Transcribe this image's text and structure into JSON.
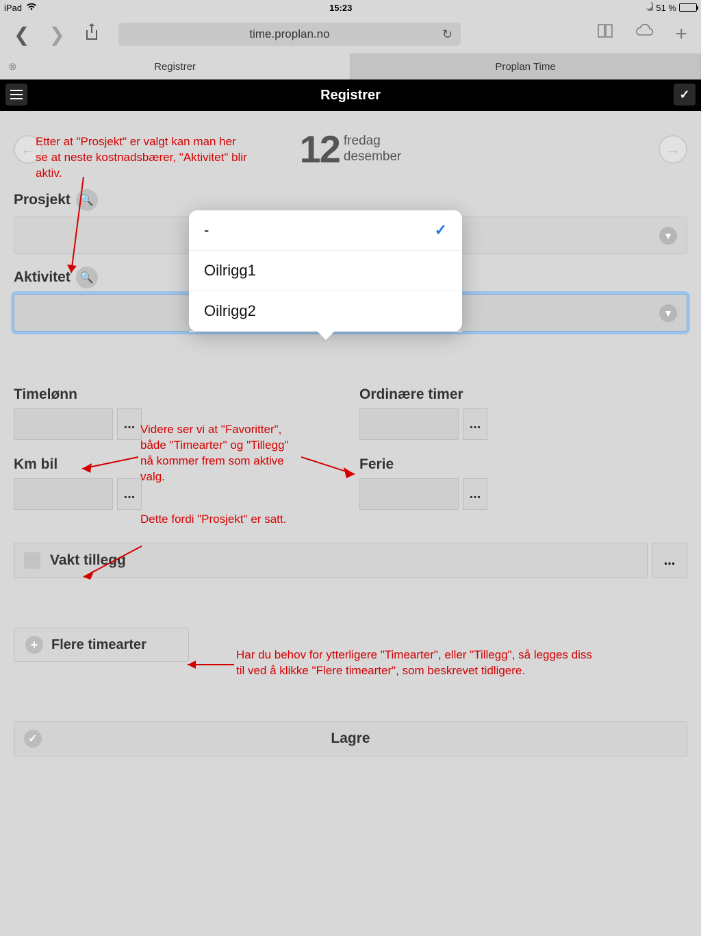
{
  "status": {
    "device": "iPad",
    "time": "15:23",
    "battery_pct": "51 %"
  },
  "browser": {
    "url": "time.proplan.no"
  },
  "tabs": {
    "active": "Registrer",
    "inactive": "Proplan Time"
  },
  "header": {
    "title": "Registrer"
  },
  "date": {
    "day_num": "12",
    "weekday": "fredag",
    "month": "desember"
  },
  "sections": {
    "prosjekt_label": "Prosjekt",
    "aktivitet_label": "Aktivitet",
    "aktivitet_value": "-"
  },
  "popover": {
    "items": [
      "-",
      "Oilrigg1",
      "Oilrigg2"
    ],
    "selected_index": 0
  },
  "fields": {
    "timelonn": "Timelønn",
    "ordinaere": "Ordinære timer",
    "kmbil": "Km bil",
    "ferie": "Ferie",
    "dots": "..."
  },
  "vakt": {
    "label": "Vakt tillegg",
    "dots": "..."
  },
  "more": {
    "label": "Flere timearter"
  },
  "save": {
    "label": "Lagre"
  },
  "annotations": {
    "a1": "Etter at \"Prosjekt\" er valgt kan man her se at neste kostnadsbærer, \"Aktivitet\" blir aktiv.",
    "a2": "Videre ser vi at \"Favoritter\", både \"Timearter\" og \"Tillegg\" nå kommer frem som aktive valg.",
    "a3": "Dette fordi \"Prosjekt\" er satt.",
    "a4": "Har du behov for ytterligere \"Timearter\", eller \"Tillegg\", så legges diss til ved å klikke \"Flere timearter\", som beskrevet tidligere."
  }
}
